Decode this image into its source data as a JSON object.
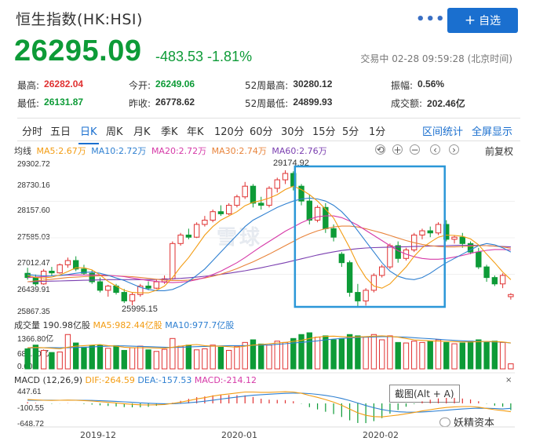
{
  "header": {
    "title": "恒生指数(HK:HSI)",
    "more": "•••",
    "add_label": "自选",
    "add_icon": "plus-icon"
  },
  "quote": {
    "price": "26295.09",
    "change": "-483.53 -1.81%",
    "status": "交易中 02-28 09:59:28 (北京时间)",
    "fields": [
      {
        "label": "最高:",
        "value": "26282.04",
        "tone": "red"
      },
      {
        "label": "今开:",
        "value": "26249.06",
        "tone": "green"
      },
      {
        "label": "52周最高:",
        "value": "30280.12",
        "tone": "plain"
      },
      {
        "label": "振幅:",
        "value": "0.56%",
        "tone": "plain"
      },
      {
        "label": "最低:",
        "value": "26131.87",
        "tone": "green"
      },
      {
        "label": "昨收:",
        "value": "26778.62",
        "tone": "plain"
      },
      {
        "label": "52周最低:",
        "value": "24899.93",
        "tone": "plain"
      },
      {
        "label": "成交额:",
        "value": "202.46亿",
        "tone": "plain"
      }
    ]
  },
  "tabs": [
    "分时",
    "五日",
    "日K",
    "周K",
    "月K",
    "季K",
    "年K",
    "120分",
    "60分",
    "30分",
    "15分",
    "5分",
    "1分"
  ],
  "active_tab": "日K",
  "tab_links": [
    "区间统计",
    "全屏显示"
  ],
  "ma_legend": [
    {
      "text": "均线",
      "color": "#333333"
    },
    {
      "text": "MA5:2.67万",
      "color": "#f39c12"
    },
    {
      "text": "MA10:2.72万",
      "color": "#2f80d1"
    },
    {
      "text": "MA20:2.72万",
      "color": "#d63aa8"
    },
    {
      "text": "MA30:2.74万",
      "color": "#e8833a"
    },
    {
      "text": "MA60:2.76万",
      "color": "#7b3fb0"
    }
  ],
  "controls": [
    "⟲",
    "+",
    "−",
    "‹",
    "›"
  ],
  "fq_label": "前复权",
  "price_axis": [
    "29302.72",
    "28730.16",
    "28157.60",
    "27585.03",
    "27012.47",
    "26439.91",
    "25867.35"
  ],
  "high_marker": "29174.92",
  "low_marker": "25995.15",
  "vol_legend": [
    {
      "text": "成交量 190.98亿股",
      "color": "#333333"
    },
    {
      "text": "MA5:982.44亿股",
      "color": "#f39c12"
    },
    {
      "text": "MA10:977.7亿股",
      "color": "#2f80d1"
    }
  ],
  "vol_axis": [
    "1366.80亿",
    "683.40亿",
    "0.00"
  ],
  "macd_legend": [
    {
      "text": "MACD (12,26,9)",
      "color": "#333333"
    },
    {
      "text": "DIF:-264.59",
      "color": "#f39c12"
    },
    {
      "text": "DEA:-157.53",
      "color": "#2f80d1"
    },
    {
      "text": "MACD:-214.12",
      "color": "#d63aa8"
    }
  ],
  "macd_axis": [
    "447.61",
    "-100.55",
    "-648.72"
  ],
  "dates": [
    "2019-12",
    "2020-01",
    "2020-02"
  ],
  "tooltip": "截图(Alt + A)",
  "watermark": "妖精资本",
  "bg_watermark": "雪球",
  "chart_data": {
    "type": "candlestick",
    "up_color": "#e03131",
    "down_color": "#0d9b37",
    "ylim": [
      25867.35,
      29302.72
    ],
    "vol_ylim": [
      0,
      1366.8
    ],
    "macd_ylim": [
      -648.72,
      447.61
    ],
    "series": [
      {
        "o": 26750,
        "h": 26880,
        "l": 26600,
        "c": 26650,
        "v": 760
      },
      {
        "o": 26650,
        "h": 26720,
        "l": 26450,
        "c": 26500,
        "v": 900
      },
      {
        "o": 26500,
        "h": 26850,
        "l": 26480,
        "c": 26800,
        "v": 700
      },
      {
        "o": 26800,
        "h": 26900,
        "l": 26700,
        "c": 26760,
        "v": 620
      },
      {
        "o": 26760,
        "h": 26980,
        "l": 26740,
        "c": 26950,
        "v": 640
      },
      {
        "o": 26950,
        "h": 27120,
        "l": 26880,
        "c": 27050,
        "v": 1300
      },
      {
        "o": 27050,
        "h": 27150,
        "l": 26800,
        "c": 26850,
        "v": 980
      },
      {
        "o": 26850,
        "h": 26950,
        "l": 26700,
        "c": 26750,
        "v": 820
      },
      {
        "o": 26750,
        "h": 26820,
        "l": 26500,
        "c": 26550,
        "v": 880
      },
      {
        "o": 26550,
        "h": 26650,
        "l": 26300,
        "c": 26350,
        "v": 900
      },
      {
        "o": 26350,
        "h": 26480,
        "l": 26200,
        "c": 26450,
        "v": 780
      },
      {
        "o": 26450,
        "h": 26500,
        "l": 26250,
        "c": 26300,
        "v": 880
      },
      {
        "o": 26300,
        "h": 26380,
        "l": 26050,
        "c": 26100,
        "v": 700
      },
      {
        "o": 26100,
        "h": 26300,
        "l": 25995,
        "c": 26250,
        "v": 800
      },
      {
        "o": 26250,
        "h": 26500,
        "l": 26200,
        "c": 26450,
        "v": 860
      },
      {
        "o": 26450,
        "h": 26560,
        "l": 26350,
        "c": 26400,
        "v": 720
      },
      {
        "o": 26400,
        "h": 26600,
        "l": 26380,
        "c": 26550,
        "v": 660
      },
      {
        "o": 26550,
        "h": 26700,
        "l": 26500,
        "c": 26620,
        "v": 740
      },
      {
        "o": 26620,
        "h": 27500,
        "l": 26600,
        "c": 27450,
        "v": 1150
      },
      {
        "o": 27450,
        "h": 27700,
        "l": 27400,
        "c": 27650,
        "v": 860
      },
      {
        "o": 27650,
        "h": 27800,
        "l": 27550,
        "c": 27600,
        "v": 900
      },
      {
        "o": 27600,
        "h": 27950,
        "l": 27580,
        "c": 27900,
        "v": 720
      },
      {
        "o": 27900,
        "h": 28100,
        "l": 27850,
        "c": 28000,
        "v": 760
      },
      {
        "o": 28000,
        "h": 28250,
        "l": 27950,
        "c": 28200,
        "v": 900
      },
      {
        "o": 28200,
        "h": 28350,
        "l": 28100,
        "c": 28150,
        "v": 820
      },
      {
        "o": 28150,
        "h": 28400,
        "l": 28120,
        "c": 28350,
        "v": 700
      },
      {
        "o": 28350,
        "h": 28600,
        "l": 28300,
        "c": 28550,
        "v": 860
      },
      {
        "o": 28550,
        "h": 28900,
        "l": 28500,
        "c": 28800,
        "v": 1000
      },
      {
        "o": 28800,
        "h": 28850,
        "l": 28300,
        "c": 28400,
        "v": 1100
      },
      {
        "o": 28400,
        "h": 28550,
        "l": 28250,
        "c": 28350,
        "v": 940
      },
      {
        "o": 28350,
        "h": 28800,
        "l": 28300,
        "c": 28750,
        "v": 900
      },
      {
        "o": 28750,
        "h": 29000,
        "l": 28650,
        "c": 28950,
        "v": 1050
      },
      {
        "o": 28950,
        "h": 29174.92,
        "l": 28850,
        "c": 29100,
        "v": 1000
      },
      {
        "o": 29100,
        "h": 29150,
        "l": 28700,
        "c": 28800,
        "v": 1150
      },
      {
        "o": 28800,
        "h": 28850,
        "l": 28350,
        "c": 28450,
        "v": 1300
      },
      {
        "o": 28450,
        "h": 28600,
        "l": 27900,
        "c": 28000,
        "v": 1366
      },
      {
        "o": 28000,
        "h": 28350,
        "l": 27950,
        "c": 28300,
        "v": 1200
      },
      {
        "o": 28300,
        "h": 28400,
        "l": 27700,
        "c": 27800,
        "v": 1250
      },
      {
        "o": 27800,
        "h": 27900,
        "l": 27500,
        "c": 27600,
        "v": 1100
      },
      {
        "o": 27200,
        "h": 27250,
        "l": 26900,
        "c": 27000,
        "v": 1150
      },
      {
        "o": 27000,
        "h": 27050,
        "l": 26200,
        "c": 26300,
        "v": 1300
      },
      {
        "o": 26300,
        "h": 26500,
        "l": 25950,
        "c": 26100,
        "v": 1250
      },
      {
        "o": 26100,
        "h": 26400,
        "l": 25990,
        "c": 26350,
        "v": 1200
      },
      {
        "o": 26350,
        "h": 26750,
        "l": 26300,
        "c": 26700,
        "v": 1300
      },
      {
        "o": 26700,
        "h": 26950,
        "l": 26650,
        "c": 26900,
        "v": 1100
      },
      {
        "o": 26900,
        "h": 27450,
        "l": 26850,
        "c": 27400,
        "v": 1250
      },
      {
        "o": 27400,
        "h": 27500,
        "l": 27000,
        "c": 27100,
        "v": 1000
      },
      {
        "o": 27100,
        "h": 27350,
        "l": 27050,
        "c": 27300,
        "v": 980
      },
      {
        "o": 27300,
        "h": 27700,
        "l": 27250,
        "c": 27650,
        "v": 1050
      },
      {
        "o": 27650,
        "h": 27800,
        "l": 27550,
        "c": 27750,
        "v": 1000
      },
      {
        "o": 27750,
        "h": 27850,
        "l": 27600,
        "c": 27700,
        "v": 1050
      },
      {
        "o": 27700,
        "h": 27950,
        "l": 27650,
        "c": 27900,
        "v": 1100
      },
      {
        "o": 27900,
        "h": 28000,
        "l": 27500,
        "c": 27550,
        "v": 1000
      },
      {
        "o": 27550,
        "h": 27650,
        "l": 27450,
        "c": 27600,
        "v": 950
      },
      {
        "o": 27600,
        "h": 27700,
        "l": 27350,
        "c": 27450,
        "v": 980
      },
      {
        "o": 27450,
        "h": 27500,
        "l": 27200,
        "c": 27250,
        "v": 1050
      },
      {
        "o": 27250,
        "h": 27350,
        "l": 26850,
        "c": 26900,
        "v": 1100
      },
      {
        "o": 26900,
        "h": 26950,
        "l": 26550,
        "c": 26650,
        "v": 1000
      },
      {
        "o": 26650,
        "h": 26700,
        "l": 26450,
        "c": 26500,
        "v": 1050
      },
      {
        "o": 26500,
        "h": 26750,
        "l": 26400,
        "c": 26700,
        "v": 1000
      },
      {
        "o": 26200,
        "h": 26282,
        "l": 26131,
        "c": 26250,
        "v": 190.98
      }
    ],
    "ma5": [
      26700,
      26650,
      26640,
      26660,
      26710,
      26790,
      26880,
      26880,
      26830,
      26710,
      26560,
      26450,
      26350,
      26300,
      26290,
      26290,
      26350,
      26450,
      26650,
      26900,
      27120,
      27380,
      27650,
      27850,
      28000,
      28100,
      28200,
      28340,
      28420,
      28460,
      28520,
      28600,
      28720,
      28800,
      28720,
      28600,
      28450,
      28260,
      28050,
      27700,
      27350,
      26950,
      26650,
      26450,
      26400,
      26500,
      26700,
      26900,
      27150,
      27350,
      27480,
      27600,
      27650,
      27640,
      27620,
      27560,
      27420,
      27200,
      27000,
      26780,
      26600
    ],
    "ma10": [
      26720,
      26700,
      26690,
      26690,
      26700,
      26720,
      26750,
      26770,
      26780,
      26750,
      26700,
      26640,
      26580,
      26500,
      26420,
      26370,
      26340,
      26340,
      26370,
      26450,
      26560,
      26700,
      26850,
      27050,
      27250,
      27450,
      27650,
      27850,
      28000,
      28100,
      28200,
      28300,
      28380,
      28450,
      28500,
      28520,
      28500,
      28450,
      28350,
      28200,
      28000,
      27750,
      27500,
      27250,
      27000,
      26800,
      26680,
      26620,
      26600,
      26650,
      26750,
      26880,
      27000,
      27100,
      27200,
      27300,
      27400,
      27450,
      27420,
      27350,
      27250
    ],
    "ma20": [
      26650,
      26660,
      26670,
      26690,
      26700,
      26710,
      26710,
      26710,
      26710,
      26710,
      26700,
      26690,
      26670,
      26640,
      26610,
      26580,
      26560,
      26540,
      26530,
      26540,
      26560,
      26600,
      26650,
      26720,
      26800,
      26900,
      27000,
      27120,
      27250,
      27380,
      27500,
      27620,
      27740,
      27840,
      27940,
      28020,
      28080,
      28100,
      28100,
      28060,
      27980,
      27880,
      27760,
      27640,
      27520,
      27400,
      27280,
      27200,
      27140,
      27100,
      27080,
      27080,
      27100,
      27130,
      27170,
      27220,
      27260,
      27290,
      27310,
      27310,
      27300
    ],
    "ma30": [
      26550,
      26570,
      26590,
      26610,
      26630,
      26650,
      26660,
      26670,
      26680,
      26690,
      26690,
      26690,
      26680,
      26670,
      26650,
      26630,
      26610,
      26590,
      26580,
      26580,
      26590,
      26610,
      26640,
      26680,
      26730,
      26790,
      26860,
      26940,
      27020,
      27110,
      27200,
      27300,
      27400,
      27500,
      27600,
      27680,
      27750,
      27800,
      27840,
      27860,
      27860,
      27840,
      27800,
      27750,
      27700,
      27640,
      27580,
      27520,
      27470,
      27430,
      27400,
      27380,
      27370,
      27370,
      27380,
      27390,
      27400,
      27400,
      27390,
      27370,
      27340
    ],
    "ma60": [
      26550,
      26555,
      26560,
      26565,
      26570,
      26575,
      26580,
      26585,
      26590,
      26595,
      26600,
      26600,
      26600,
      26600,
      26600,
      26600,
      26605,
      26610,
      26620,
      26630,
      26645,
      26660,
      26680,
      26700,
      26725,
      26750,
      26780,
      26810,
      26845,
      26880,
      26920,
      26960,
      27000,
      27045,
      27090,
      27135,
      27180,
      27220,
      27255,
      27285,
      27310,
      27330,
      27345,
      27355,
      27360,
      27365,
      27370,
      27375,
      27380,
      27385,
      27390,
      27395,
      27400,
      27405,
      27410,
      27410,
      27405,
      27400,
      27390,
      27380,
      27370
    ],
    "vol_ma5": [
      800,
      810,
      800,
      780,
      760,
      820,
      860,
      880,
      900,
      920,
      880,
      860,
      820,
      800,
      800,
      800,
      790,
      780,
      820,
      860,
      900,
      920,
      880,
      860,
      860,
      840,
      820,
      860,
      900,
      920,
      950,
      980,
      1000,
      1040,
      1080,
      1150,
      1200,
      1230,
      1240,
      1220,
      1200,
      1210,
      1220,
      1240,
      1250,
      1230,
      1200,
      1150,
      1100,
      1080,
      1060,
      1050,
      1040,
      1030,
      1020,
      1020,
      1030,
      1040,
      1030,
      1020,
      982
    ],
    "vol_ma10": [
      790,
      795,
      800,
      805,
      800,
      800,
      810,
      820,
      830,
      850,
      860,
      870,
      870,
      860,
      850,
      840,
      830,
      820,
      810,
      820,
      830,
      840,
      850,
      860,
      870,
      880,
      880,
      880,
      890,
      900,
      910,
      930,
      950,
      980,
      1000,
      1030,
      1060,
      1100,
      1130,
      1150,
      1170,
      1190,
      1200,
      1210,
      1220,
      1220,
      1210,
      1200,
      1180,
      1160,
      1140,
      1120,
      1100,
      1080,
      1060,
      1050,
      1040,
      1030,
      1020,
      1010,
      978
    ],
    "dif": [
      120,
      110,
      100,
      95,
      98,
      105,
      100,
      90,
      75,
      55,
      35,
      15,
      -10,
      -30,
      -45,
      -50,
      -45,
      -35,
      0,
      40,
      90,
      140,
      180,
      230,
      270,
      300,
      330,
      360,
      360,
      350,
      350,
      360,
      370,
      360,
      320,
      250,
      190,
      120,
      40,
      -60,
      -180,
      -300,
      -380,
      -420,
      -430,
      -400,
      -370,
      -330,
      -290,
      -240,
      -200,
      -160,
      -130,
      -110,
      -100,
      -100,
      -120,
      -160,
      -200,
      -230,
      -264.59
    ],
    "dea": [
      100,
      102,
      102,
      101,
      100,
      101,
      101,
      99,
      94,
      86,
      76,
      64,
      49,
      33,
      17,
      4,
      -6,
      -12,
      -10,
      0,
      18,
      42,
      70,
      102,
      135,
      168,
      200,
      232,
      258,
      276,
      291,
      305,
      318,
      326,
      325,
      310,
      286,
      253,
      210,
      156,
      89,
      11,
      -67,
      -138,
      -196,
      -237,
      -264,
      -277,
      -280,
      -272,
      -258,
      -238,
      -217,
      -196,
      -177,
      -162,
      -154,
      -155,
      -164,
      -177,
      -157.53
    ]
  }
}
